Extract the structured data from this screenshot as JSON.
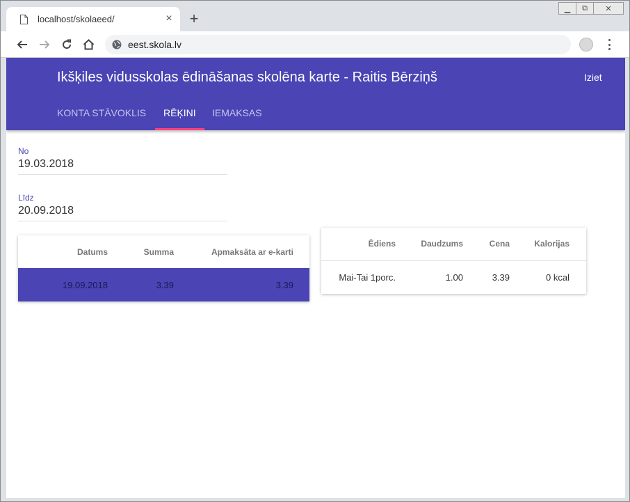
{
  "browser": {
    "tab_title": "localhost/skolaeed/",
    "url": "eest.skola.lv"
  },
  "app": {
    "title": "Ikšķiles vidusskolas ēdināšanas skolēna karte - Raitis Bērziņš",
    "logout_label": "Iziet",
    "tabs": [
      {
        "label": "KONTA STĀVOKLIS"
      },
      {
        "label": "RĒĶINI"
      },
      {
        "label": "IEMAKSAS"
      }
    ],
    "active_tab": "RĒĶINI",
    "accent_color": "#4a44b4",
    "ink_color": "#ff4081"
  },
  "filters": {
    "from_label": "No",
    "from_value": "19.03.2018",
    "to_label": "Līdz",
    "to_value": "20.09.2018"
  },
  "invoices": {
    "headers": [
      "Datums",
      "Summa",
      "Apmaksāta ar e-karti"
    ],
    "rows": [
      [
        "19.09.2018",
        "3.39",
        "3.39"
      ]
    ]
  },
  "items": {
    "headers": [
      "Ēdiens",
      "Daudzums",
      "Cena",
      "Kalorijas"
    ],
    "rows": [
      [
        "Mai-Tai 1porc.",
        "1.00",
        "3.39",
        "0 kcal"
      ]
    ]
  }
}
